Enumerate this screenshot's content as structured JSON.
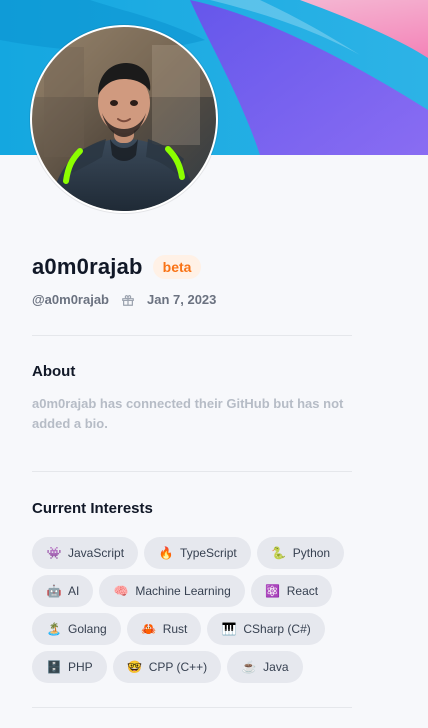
{
  "profile": {
    "username": "a0m0rajab",
    "badge": "beta",
    "handle": "@a0m0rajab",
    "joined": "Jan 7, 2023"
  },
  "about": {
    "title": "About",
    "bio": "a0m0rajab has connected their GitHub but has not added a bio."
  },
  "interests": {
    "title": "Current Interests",
    "items": [
      {
        "emoji": "👾",
        "label": "JavaScript"
      },
      {
        "emoji": "🔥",
        "label": "TypeScript"
      },
      {
        "emoji": "🐍",
        "label": "Python"
      },
      {
        "emoji": "🤖",
        "label": "AI"
      },
      {
        "emoji": "🧠",
        "label": "Machine Learning"
      },
      {
        "emoji": "⚛️",
        "label": "React"
      },
      {
        "emoji": "🏝️",
        "label": "Golang"
      },
      {
        "emoji": "🦀",
        "label": "Rust"
      },
      {
        "emoji": "🎹",
        "label": "CSharp (C#)"
      },
      {
        "emoji": "🗄️",
        "label": "PHP"
      },
      {
        "emoji": "🤓",
        "label": "CPP (C++)"
      },
      {
        "emoji": "☕",
        "label": "Java"
      }
    ]
  },
  "colors": {
    "accent_orange": "#f97316",
    "chip_bg": "#e6e8ee",
    "page_bg": "#f7f8fb"
  },
  "icons": {
    "gift": "gift-icon"
  }
}
